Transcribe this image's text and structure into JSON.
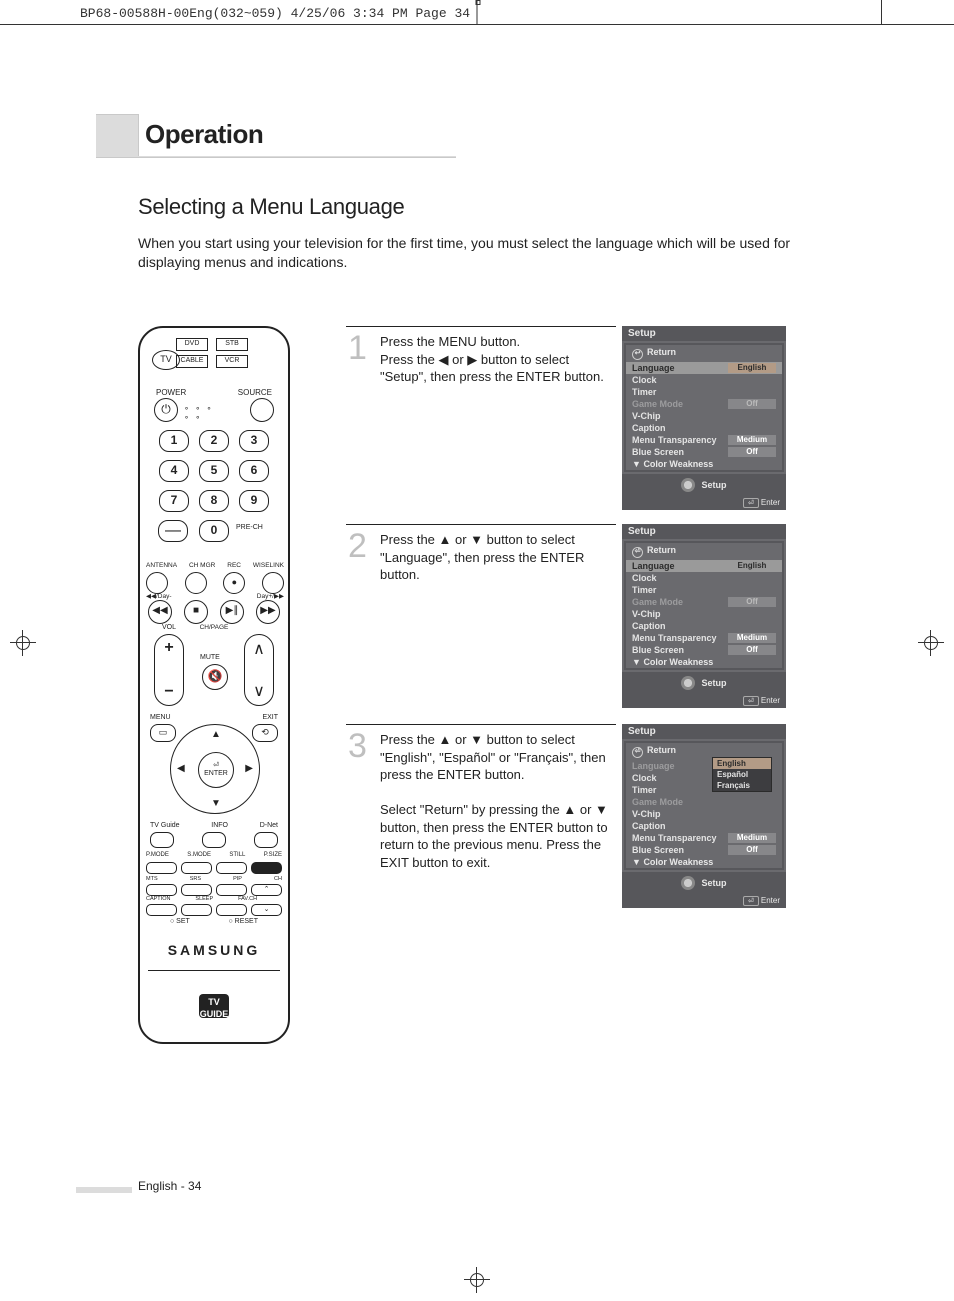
{
  "header": {
    "crop_info": "BP68-00588H-00Eng(032~059)  4/25/06  3:34 PM  Page 34"
  },
  "banner": {
    "title": "Operation"
  },
  "subtitle": "Selecting a Menu Language",
  "intro": "When you start using your television for the first time, you must select the language which will be used for displaying menus and indications.",
  "steps": {
    "s1": {
      "num": "1",
      "text": "Press the MENU button.\nPress the ◀ or ▶ button to select \"Setup\", then press the ENTER button."
    },
    "s2": {
      "num": "2",
      "text": "Press the ▲ or ▼ button to select \"Language\", then press the ENTER button."
    },
    "s3": {
      "num": "3",
      "text": "Press the ▲ or ▼ button to select \"English\", \"Español\" or \"Français\", then press the ENTER button.\n\nSelect \"Return\" by pressing the ▲ or ▼ button, then press the ENTER button to return to the previous menu. Press the EXIT button to exit."
    }
  },
  "remote": {
    "brand": "SAMSUNG",
    "src": {
      "dvd": "DVD",
      "stb": "STB",
      "cable": "CABLE",
      "vcr": "VCR",
      "tv": "TV"
    },
    "labels": {
      "power": "POWER",
      "source": "SOURCE",
      "prech": "PRE-CH",
      "antenna": "ANTENNA",
      "chmgr": "CH MGR",
      "rec": "REC",
      "wiselink": "WISELINK",
      "dayminus": "◀◀/Day-",
      "dayplus": "Day+/▶▶",
      "vol": "VOL",
      "chpage": "CH/PAGE",
      "mute": "MUTE",
      "menu": "MENU",
      "exit": "EXIT",
      "enter_icon": "⏎",
      "enter": "ENTER",
      "tvguide": "TV Guide",
      "info": "INFO",
      "dnet": "D-Net",
      "pmode": "P.MODE",
      "smode": "S.MODE",
      "still": "STILL",
      "psize": "P.SIZE",
      "mts": "MTS",
      "srs": "SRS",
      "pip": "PIP",
      "up": "⌃",
      "caption": "CAPTION",
      "sleep": "SLEEP",
      "favch": "FAV.CH",
      "ch": "CH",
      "down": "⌄",
      "set": "○ SET",
      "reset": "○ RESET",
      "tvg": "TV\nGUIDE"
    },
    "nums": [
      "1",
      "2",
      "3",
      "4",
      "5",
      "6",
      "7",
      "8",
      "9",
      "",
      "0",
      ""
    ]
  },
  "osd": {
    "title": "Setup",
    "return": "Return",
    "footer_label": "Setup",
    "enter_key": "⏎",
    "enter": "Enter",
    "items": {
      "language": "Language",
      "clock": "Clock",
      "timer": "Timer",
      "game": "Game Mode",
      "vchip": "V-Chip",
      "caption": "Caption",
      "menutrans": "Menu Transparency",
      "bluescreen": "Blue Screen",
      "colorweak": "Color Weakness"
    },
    "vals": {
      "english": "English",
      "off": "Off",
      "medium": "Medium"
    },
    "dropdown": {
      "english": "English",
      "espanol": "Español",
      "francais": "Français"
    },
    "more": "▼"
  },
  "footer": {
    "page": "English - 34"
  }
}
